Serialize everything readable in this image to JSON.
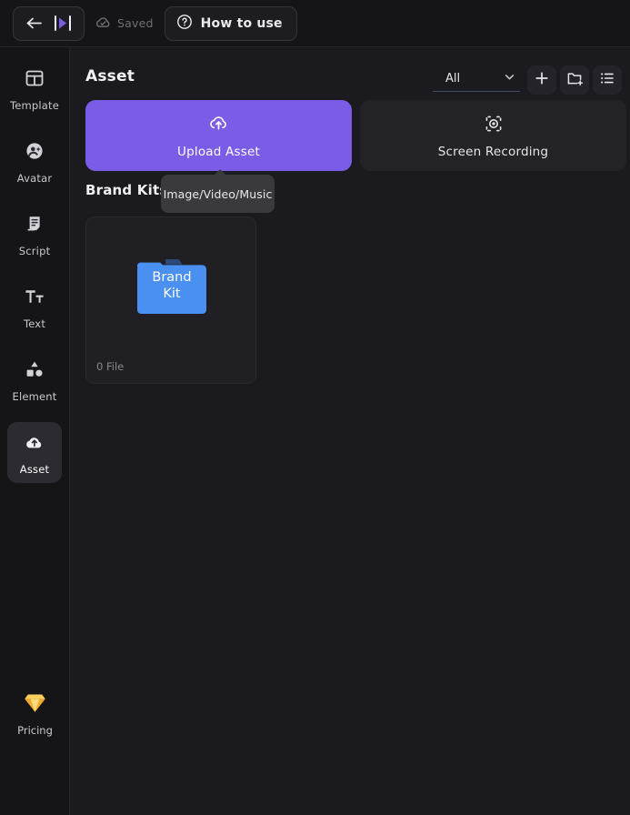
{
  "topbar": {
    "back_icon": "arrow-left-icon",
    "logo_icon": "play-marker-logo",
    "saved_label": "Saved",
    "saved_icon": "cloud-check-icon",
    "how_to_use_label": "How to use",
    "help_icon": "question-circle-icon"
  },
  "sidebar": {
    "items": [
      {
        "label": "Template",
        "icon": "template-icon",
        "active": false
      },
      {
        "label": "Avatar",
        "icon": "avatar-icon",
        "active": false
      },
      {
        "label": "Script",
        "icon": "script-icon",
        "active": false
      },
      {
        "label": "Text",
        "icon": "text-icon",
        "active": false
      },
      {
        "label": "Element",
        "icon": "element-icon",
        "active": false
      },
      {
        "label": "Asset",
        "icon": "asset-cloud-icon",
        "active": true
      }
    ],
    "pricing": {
      "label": "Pricing",
      "icon": "diamond-gem-icon"
    }
  },
  "main": {
    "page_title": "Asset",
    "filter": {
      "value": "All",
      "chevron_icon": "chevron-down-icon"
    },
    "actions": [
      {
        "name": "add-button",
        "icon": "plus-icon"
      },
      {
        "name": "new-folder-button",
        "icon": "folder-plus-icon"
      },
      {
        "name": "list-view-button",
        "icon": "list-icon"
      }
    ],
    "upload_asset": {
      "label": "Upload Asset",
      "icon": "cloud-upload-icon"
    },
    "screen_recording": {
      "label": "Screen Recording",
      "icon": "screen-capture-icon"
    },
    "tooltip": "Image/Video/Music",
    "section_title": "Brand Kits",
    "brand_kit": {
      "name_line1": "Brand",
      "name_line2": "Kit",
      "file_count": "0 File",
      "folder_icon": "blue-folder-icon"
    }
  },
  "colors": {
    "accent_purple": "#7b5ce6",
    "folder_blue": "#4a90f0",
    "pricing_gold": "#f2b137",
    "background": "#1a1a1f",
    "panel": "#151518",
    "filter_underline": "#3e4c63"
  }
}
